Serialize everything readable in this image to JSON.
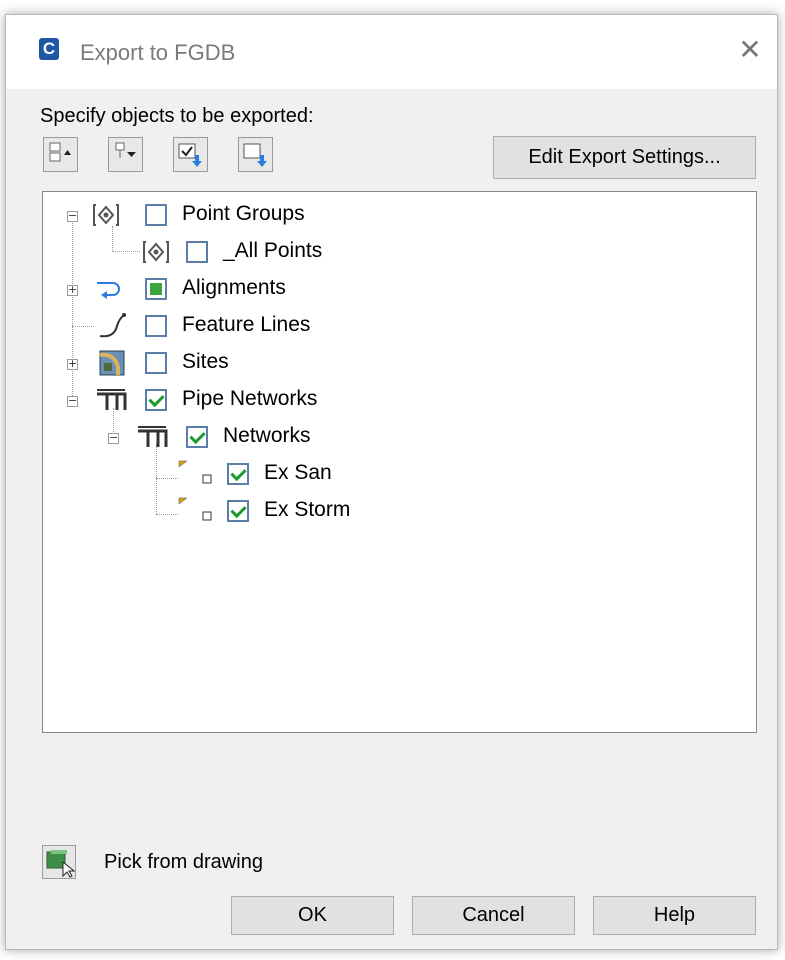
{
  "window": {
    "title": "Export to FGDB",
    "app_icon_letter": "C",
    "close_glyph": "✕"
  },
  "prompt": "Specify objects to be exported:",
  "toolbar": {
    "buttons": [
      {
        "icon": "collapse-all-icon"
      },
      {
        "icon": "expand-all-icon"
      },
      {
        "icon": "select-all-icon"
      },
      {
        "icon": "clear-all-icon"
      }
    ],
    "edit_settings_label": "Edit Export Settings..."
  },
  "tree": {
    "point_groups": {
      "label": "Point Groups",
      "checked": false
    },
    "all_points": {
      "label": "_All Points",
      "checked": false
    },
    "alignments": {
      "label": "Alignments",
      "state": "partial"
    },
    "feature_lines": {
      "label": "Feature Lines",
      "checked": false
    },
    "sites": {
      "label": "Sites",
      "checked": false
    },
    "pipe_networks": {
      "label": "Pipe Networks",
      "checked": true
    },
    "networks": {
      "label": "Networks",
      "checked": true
    },
    "ex_san": {
      "label": "Ex San",
      "checked": true
    },
    "ex_storm": {
      "label": "Ex Storm",
      "checked": true
    }
  },
  "pick": {
    "label": "Pick from drawing"
  },
  "buttons": {
    "ok": "OK",
    "cancel": "Cancel",
    "help": "Help"
  },
  "colors": {
    "checkmark": "#1a9a2e",
    "checkbox_border": "#5a7ea8",
    "app_icon": "#1f57a6"
  }
}
